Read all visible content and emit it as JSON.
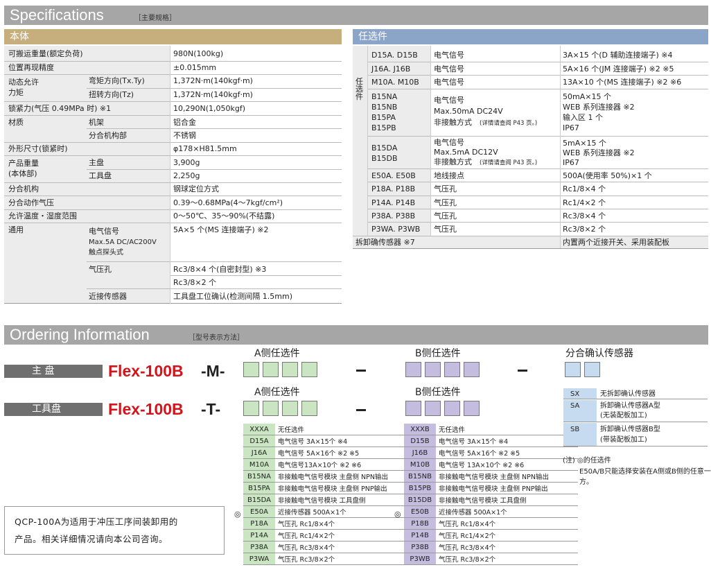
{
  "spec_header": {
    "title": "Specifications",
    "subtitle": "［主要规格］"
  },
  "body_section": {
    "title": "本体"
  },
  "option_section": {
    "title": "任选件"
  },
  "spec": {
    "r1": {
      "l": "可搬运重量(额定负荷)",
      "v": "980N(100kg)"
    },
    "r2": {
      "l": "位置再现精度",
      "v": "±0.015mm"
    },
    "r3": {
      "l1": "动态允许",
      "l2": "力矩",
      "s1": "弯矩方向(Tx.Ty)",
      "v1": "1,372N·m(140kgf·m)",
      "s2": "扭转方向(Tz)",
      "v2": "1,372N·m(140kgf·m)"
    },
    "r4": {
      "l": "锁紧力(气压 0.49MPa 时) ※1",
      "v": "10,290N(1,050kgf)"
    },
    "r5": {
      "l": "材质",
      "s1": "机架",
      "v1": "铝合金",
      "s2": "分合机构部",
      "v2": "不锈钢"
    },
    "r6": {
      "l": "外形尺寸(锁紧时)",
      "v": "φ178×H81.5mm"
    },
    "r7": {
      "l1": "产品重量",
      "l2": "(本体部)",
      "s1": "主盘",
      "v1": "3,900g",
      "s2": "工具盘",
      "v2": "2,250g"
    },
    "r8": {
      "l": "分合机构",
      "v": "钢球定位方式"
    },
    "r9": {
      "l": "分合动作气压",
      "v": "0.39～0.68MPa(4～7kgf/cm²)"
    },
    "r10": {
      "l": "允许温度・湿度范围",
      "v": "0～50℃、35～90%(不结露)"
    },
    "r11": {
      "l": "通用",
      "s1a": "电气信号",
      "s1b": "Max.5A  DC/AC200V",
      "s1c": "触点探头式",
      "v1": "5A×5 个(MS 连接端子) ※2",
      "s2": "气压孔",
      "v2a": "Rc3/8×4 个(自密封型) ※3",
      "v2b": "Rc3/8×2 个",
      "s3": "近接传感器",
      "v3": "工具盘工位确认(检测间隔 1.5mm)"
    }
  },
  "opt": {
    "side": "任选件",
    "r1": {
      "m": "D15A. D15B",
      "d": "电气信号",
      "v": "3A×15 个(D 辅助连接端子) ※4"
    },
    "r2": {
      "m": "J16A. J16B",
      "d": "电气信号",
      "v": "5A×16 个(JM 连接端子) ※2 ※5"
    },
    "r3": {
      "m": "M10A. M10B",
      "d": "电气信号",
      "v": "13A×10 个(MS 连接端子) ※2 ※6"
    },
    "r4": {
      "m1": "B15NA",
      "m2": "B15NB",
      "m3": "B15PA",
      "m4": "B15PB",
      "d1": "电气信号",
      "d2": "Max.50mA DC24V",
      "d3": "非接触方式",
      "d3n": "(详情请查阅 P43 页。)",
      "v1": "50mA×15 个",
      "v2": "WEB 系列连接器 ※2",
      "v3": "输入区   1 个",
      "v4": "IP67"
    },
    "r5": {
      "m1": "B15DA",
      "m2": "B15DB",
      "d1": "电气信号",
      "d2": "Max.5mA DC12V",
      "d3": "非接触方式",
      "d3n": "(详情请查阅 P43 页。)",
      "v1": "5mA×15 个",
      "v2": "WEB 系列连接器 ※2",
      "v3": "IP67"
    },
    "r6": {
      "m": "E50A. E50B",
      "d": "地线接点",
      "v": "500A(使用率 50%)×1 个"
    },
    "r7": {
      "m": "P18A. P18B",
      "d": "气压孔",
      "v": "Rc1/8×4 个"
    },
    "r8": {
      "m": "P14A. P14B",
      "d": "气压孔",
      "v": "Rc1/4×2 个"
    },
    "r9": {
      "m": "P38A. P38B",
      "d": "气压孔",
      "v": "Rc3/8×4 个"
    },
    "r10": {
      "m": "P3WA. P3WB",
      "d": "气压孔",
      "v": "Rc3/8×2 个"
    },
    "r11": {
      "m": "拆卸确传感器 ※7",
      "v": "内置两个近接开关、采用装配板"
    }
  },
  "order_header": {
    "title": "Ordering Information",
    "subtitle": "［型号表示方法］"
  },
  "order": {
    "master": {
      "label": "主  盘",
      "model": "Flex-100B",
      "suffix": "-M-"
    },
    "tool": {
      "label": "工具盘",
      "model": "Flex-100B",
      "suffix": "-T-"
    },
    "a_title": "A侧任选件",
    "b_title": "B侧任选件",
    "s_title": "分合确认传感器"
  },
  "a_list": [
    {
      "c": "XXXA",
      "d": "无任选件"
    },
    {
      "c": "D15A",
      "d": "电气信号 3A×15个 ※4"
    },
    {
      "c": "J16A",
      "d": "电气信号 5A×16个 ※2 ※5"
    },
    {
      "c": "M10A",
      "d": "电气信号13A×10个 ※2 ※6"
    },
    {
      "c": "B15NA",
      "d": "非接触电气信号模块 主盘侧 NPN输出"
    },
    {
      "c": "B15PA",
      "d": "非接触电气信号模块 主盘侧 PNP输出"
    },
    {
      "c": "B15DA",
      "d": "非接触电气信号模块 工具盘侧"
    },
    {
      "c": "E50A",
      "d": "近接传感器 500A×1个"
    },
    {
      "c": "P18A",
      "d": "气压孔 Rc1/8×4个"
    },
    {
      "c": "P14A",
      "d": "气压孔 Rc1/4×2个"
    },
    {
      "c": "P38A",
      "d": "气压孔 Rc3/8×4个"
    },
    {
      "c": "P3WA",
      "d": "气压孔 Rc3/8×2个"
    }
  ],
  "b_list": [
    {
      "c": "XXXB",
      "d": "无任选件"
    },
    {
      "c": "D15B",
      "d": "电气信号 3A×15个 ※4"
    },
    {
      "c": "J16B",
      "d": "电气信号 5A×16个 ※2 ※5"
    },
    {
      "c": "M10B",
      "d": "电气信号 13A×10个 ※2 ※6"
    },
    {
      "c": "B15NB",
      "d": "非接触电气信号模块 主盘侧 NPN输出"
    },
    {
      "c": "B15PB",
      "d": "非接触电气信号模块 主盘侧 PNP输出"
    },
    {
      "c": "B15DB",
      "d": "非接触电气信号模块 工具盘侧"
    },
    {
      "c": "E50B",
      "d": "近接传感器 500A×1个"
    },
    {
      "c": "P18B",
      "d": "气压孔 Rc1/8×4个"
    },
    {
      "c": "P14B",
      "d": "气压孔 Rc1/4×2个"
    },
    {
      "c": "P38B",
      "d": "气压孔 Rc3/8×4个"
    },
    {
      "c": "P3WB",
      "d": "气压孔 Rc3/8×2个"
    }
  ],
  "mark": "◎",
  "s_list": [
    {
      "c": "SX",
      "d1": "无拆卸确认传感器",
      "d2": ""
    },
    {
      "c": "SA",
      "d1": "拆卸确认传感器A型",
      "d2": "(无装配板加工)"
    },
    {
      "c": "SB",
      "d1": "拆卸确认传感器B型",
      "d2": "(带装配板加工)"
    }
  ],
  "note": {
    "l1": "(注) ◎的任选件",
    "l2": "E50A/B只能选择安装在A侧或B侧的任意一",
    "l3": "方。"
  },
  "qcp": {
    "l1": "QCP-100A为适用于冲压工序间装卸用的",
    "l2": "产品。相关详细情况请向本公司咨询。"
  },
  "colors": {
    "header_gray": "#a6a6a7",
    "body_tan": "#c7ae7d",
    "option_blue": "#8ba5c8",
    "a_green": "#c9e5c1",
    "b_purple": "#c4bddf",
    "s_blue": "#c7dbf0",
    "model_red": "#d3151b"
  }
}
